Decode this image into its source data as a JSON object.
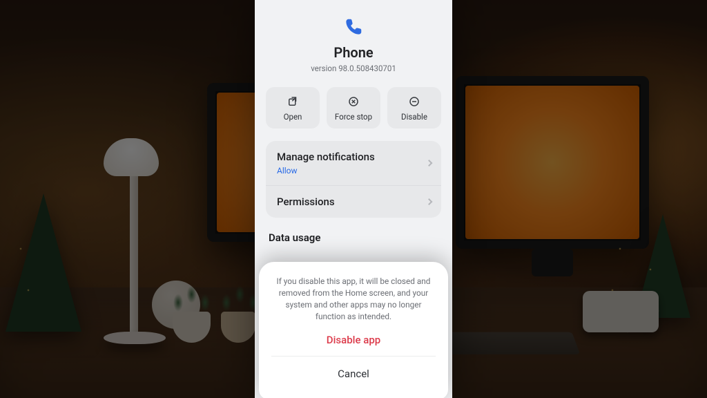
{
  "app": {
    "name": "Phone",
    "version_prefix": "version ",
    "version": "98.0.508430701"
  },
  "actions": {
    "open": "Open",
    "force_stop": "Force stop",
    "disable": "Disable"
  },
  "settings": {
    "notifications": {
      "title": "Manage notifications",
      "status": "Allow"
    },
    "permissions": {
      "title": "Permissions"
    }
  },
  "section": {
    "data_usage": "Data usage"
  },
  "dialog": {
    "message": "If you disable this app, it will be closed and removed from the Home screen, and your system and other apps may no longer function as intended.",
    "disable": "Disable app",
    "cancel": "Cancel"
  },
  "colors": {
    "destructive": "#dc3b4b",
    "link": "#2769e6"
  }
}
